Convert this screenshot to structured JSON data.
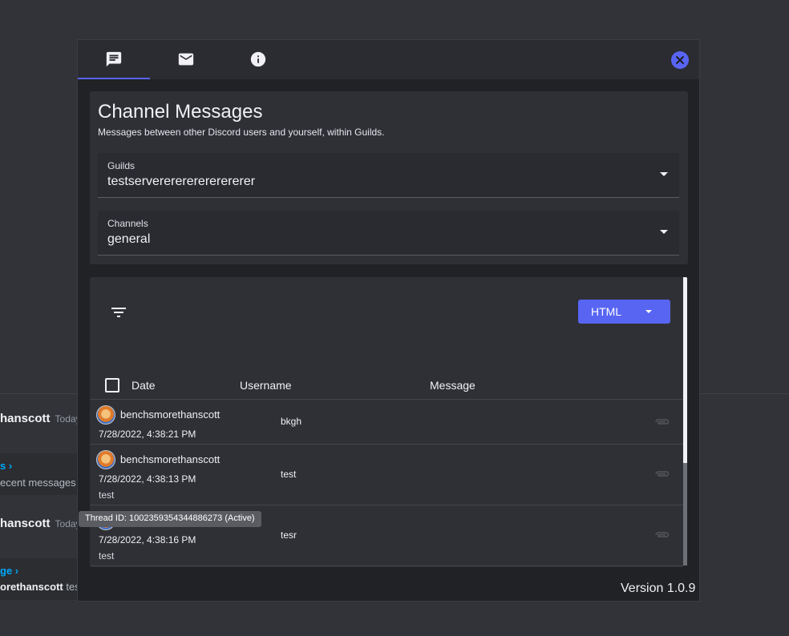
{
  "background": {
    "messages": [
      {
        "name": "hanscott",
        "time": "Today"
      },
      {
        "name": "hanscott",
        "time": "Today"
      }
    ],
    "embeds": [
      {
        "link": "s ›",
        "text": "ecent messages i"
      },
      {
        "link": "ge ›",
        "text_bold": "orethanscott",
        "text": "tesr"
      }
    ]
  },
  "tabs": [
    {
      "icon": "chat-icon"
    },
    {
      "icon": "mail-icon"
    },
    {
      "icon": "info-icon"
    }
  ],
  "close_icon": "close-icon",
  "channel_messages": {
    "title": "Channel Messages",
    "subtitle": "Messages between other Discord users and yourself, within Guilds.",
    "guilds": {
      "label": "Guilds",
      "value": "testservererererererererer"
    },
    "channels": {
      "label": "Channels",
      "value": "general"
    }
  },
  "table": {
    "filter_icon": "filter-icon",
    "export_button": {
      "label": "HTML"
    },
    "headers": {
      "date": "Date",
      "username": "Username",
      "message": "Message"
    },
    "rows": [
      {
        "username": "benchsmorethanscott",
        "date": "7/28/2022, 4:38:21 PM",
        "message": "bkgh",
        "extra": ""
      },
      {
        "username": "benchsmorethanscott",
        "date": "7/28/2022, 4:38:13 PM",
        "message": "test",
        "extra": "test"
      },
      {
        "username": "",
        "date": "7/28/2022, 4:38:16 PM",
        "message": "tesr",
        "extra": "test"
      }
    ]
  },
  "tooltip": "Thread ID: 1002359354344886273 (Active)",
  "version": "Version 1.0.9",
  "colors": {
    "accent": "#5865f2",
    "background": "#313338",
    "modal": "#202225",
    "card": "#2f3035"
  }
}
